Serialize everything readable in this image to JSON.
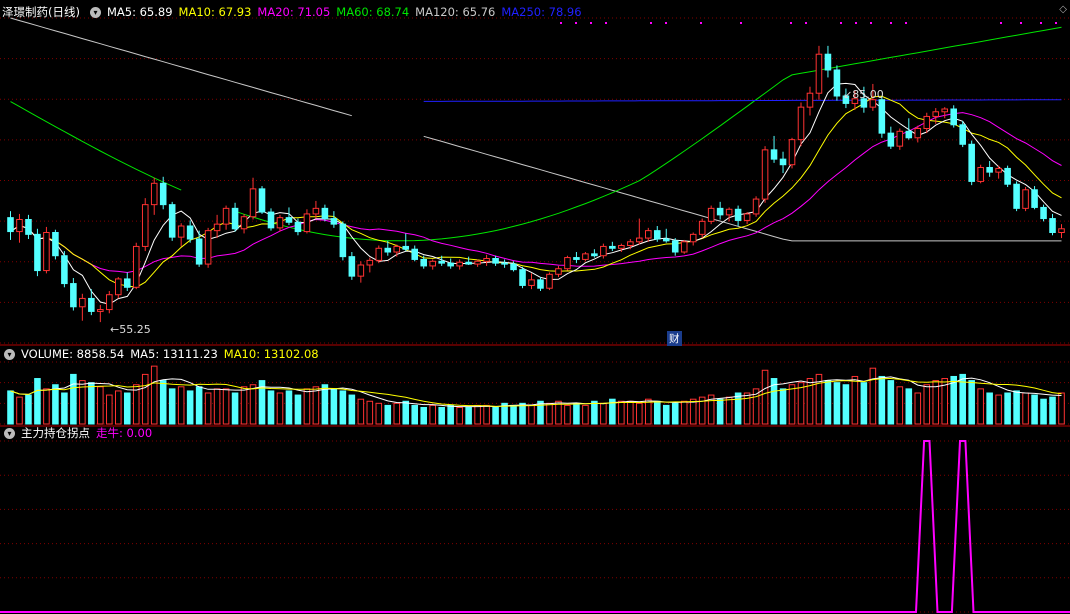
{
  "header": {
    "stock_name": "泽璟制药(日线)",
    "ma5": "MA5: 65.89",
    "ma10": "MA10: 67.93",
    "ma20": "MA20: 71.05",
    "ma60": "MA60: 68.74",
    "ma120": "MA120: 65.76",
    "ma250": "MA250: 78.96"
  },
  "volume_header": {
    "title": "VOLUME: 8858.54",
    "ma5": "MA5: 13111.23",
    "ma10": "MA10: 13102.08"
  },
  "indicator_header": {
    "title": "主力持仓拐点",
    "series": "走牛: 0.00"
  },
  "annotations": {
    "high_label": "85.00",
    "low_label": "55.25",
    "fin_marker": "财"
  },
  "colors": {
    "up": "#ff3232",
    "down": "#54ffff",
    "ma5": "#ffffff",
    "ma10": "#ffff00",
    "ma20": "#ff00ff",
    "ma60": "#00e600",
    "ma120": "#c8c8c8",
    "ma250": "#2020ff",
    "indicator": "#ff00ff",
    "grid": "#800000"
  },
  "chart_data": [
    {
      "type": "candlestick",
      "title": "泽璟制药(日线)",
      "price_range": [
        53,
        88
      ],
      "candles": [
        [
          66.5,
          67.2,
          64.1,
          65.0
        ],
        [
          65.0,
          66.9,
          63.8,
          66.3
        ],
        [
          66.3,
          66.8,
          64.2,
          64.7
        ],
        [
          64.7,
          65.3,
          60.2,
          60.8
        ],
        [
          60.8,
          65.5,
          60.5,
          64.9
        ],
        [
          64.9,
          65.2,
          62.0,
          62.4
        ],
        [
          62.4,
          62.9,
          59.0,
          59.4
        ],
        [
          59.4,
          60.0,
          56.5,
          56.9
        ],
        [
          56.9,
          58.3,
          55.4,
          57.8
        ],
        [
          57.8,
          58.8,
          56.0,
          56.4
        ],
        [
          56.4,
          57.1,
          55.25,
          56.6
        ],
        [
          56.6,
          58.6,
          56.2,
          58.2
        ],
        [
          58.2,
          60.1,
          57.8,
          59.9
        ],
        [
          59.9,
          60.6,
          58.6,
          59.0
        ],
        [
          59.0,
          63.8,
          58.8,
          63.4
        ],
        [
          63.4,
          68.6,
          62.9,
          67.9
        ],
        [
          67.9,
          70.8,
          66.8,
          70.2
        ],
        [
          70.2,
          70.9,
          67.4,
          67.9
        ],
        [
          67.9,
          68.2,
          64.0,
          64.4
        ],
        [
          64.4,
          65.9,
          63.4,
          65.6
        ],
        [
          65.6,
          66.2,
          63.8,
          64.2
        ],
        [
          64.2,
          65.1,
          61.2,
          61.5
        ],
        [
          61.5,
          65.4,
          61.1,
          65.1
        ],
        [
          65.1,
          66.8,
          64.3,
          65.8
        ],
        [
          65.8,
          67.8,
          65.2,
          67.5
        ],
        [
          67.5,
          68.1,
          65.0,
          65.3
        ],
        [
          65.3,
          66.9,
          64.8,
          66.6
        ],
        [
          66.6,
          70.8,
          66.3,
          69.6
        ],
        [
          69.6,
          69.9,
          66.9,
          67.1
        ],
        [
          67.1,
          67.5,
          65.1,
          65.4
        ],
        [
          65.4,
          66.8,
          65.0,
          66.5
        ],
        [
          66.5,
          67.6,
          65.7,
          66.0
        ],
        [
          66.0,
          66.4,
          64.6,
          65.0
        ],
        [
          65.0,
          67.4,
          64.8,
          66.9
        ],
        [
          66.9,
          68.3,
          66.4,
          67.5
        ],
        [
          67.5,
          67.9,
          66.1,
          66.4
        ],
        [
          66.4,
          67.2,
          65.4,
          65.8
        ],
        [
          65.8,
          66.1,
          61.9,
          62.3
        ],
        [
          62.3,
          62.8,
          59.8,
          60.2
        ],
        [
          60.2,
          61.8,
          59.5,
          61.4
        ],
        [
          61.4,
          62.2,
          60.6,
          61.9
        ],
        [
          61.9,
          63.5,
          61.6,
          63.2
        ],
        [
          63.2,
          64.0,
          62.4,
          62.8
        ],
        [
          62.8,
          63.6,
          62.3,
          63.4
        ],
        [
          63.4,
          64.8,
          62.9,
          63.1
        ],
        [
          63.1,
          63.5,
          61.8,
          62.0
        ],
        [
          62.0,
          62.4,
          61.0,
          61.3
        ],
        [
          61.3,
          62.0,
          60.9,
          61.8
        ],
        [
          61.8,
          62.4,
          61.3,
          61.6
        ],
        [
          61.6,
          62.1,
          61.0,
          61.3
        ],
        [
          61.3,
          62.0,
          60.9,
          61.7
        ],
        [
          61.7,
          62.3,
          61.4,
          61.5
        ],
        [
          61.5,
          62.0,
          61.2,
          61.8
        ],
        [
          61.8,
          62.5,
          61.3,
          62.1
        ],
        [
          62.1,
          62.4,
          61.3,
          61.6
        ],
        [
          61.6,
          62.0,
          61.1,
          61.5
        ],
        [
          61.5,
          61.8,
          60.7,
          60.9
        ],
        [
          60.9,
          61.2,
          58.9,
          59.2
        ],
        [
          59.2,
          60.5,
          58.8,
          59.8
        ],
        [
          59.8,
          60.1,
          58.6,
          58.9
        ],
        [
          58.9,
          60.6,
          58.7,
          60.4
        ],
        [
          60.4,
          61.3,
          60.1,
          61.0
        ],
        [
          61.0,
          62.4,
          60.8,
          62.2
        ],
        [
          62.2,
          62.8,
          61.6,
          62.0
        ],
        [
          62.0,
          62.8,
          61.8,
          62.6
        ],
        [
          62.6,
          63.1,
          62.2,
          62.4
        ],
        [
          62.4,
          63.7,
          62.1,
          63.4
        ],
        [
          63.4,
          63.9,
          62.9,
          63.2
        ],
        [
          63.2,
          63.7,
          62.8,
          63.5
        ],
        [
          63.5,
          64.2,
          63.1,
          63.9
        ],
        [
          63.9,
          66.4,
          63.6,
          64.3
        ],
        [
          64.3,
          65.4,
          63.9,
          65.1
        ],
        [
          65.1,
          65.6,
          63.9,
          64.2
        ],
        [
          64.2,
          65.3,
          63.8,
          64.0
        ],
        [
          64.0,
          64.3,
          62.4,
          62.8
        ],
        [
          62.8,
          64.1,
          62.6,
          63.9
        ],
        [
          63.9,
          64.9,
          63.5,
          64.7
        ],
        [
          64.7,
          66.4,
          64.3,
          66.1
        ],
        [
          66.1,
          67.8,
          65.8,
          67.5
        ],
        [
          67.5,
          68.2,
          66.3,
          66.8
        ],
        [
          66.8,
          67.6,
          66.1,
          67.4
        ],
        [
          67.4,
          67.8,
          65.6,
          66.2
        ],
        [
          66.2,
          67.1,
          65.8,
          66.9
        ],
        [
          66.9,
          68.8,
          66.6,
          68.5
        ],
        [
          68.5,
          74.2,
          68.1,
          73.8
        ],
        [
          73.8,
          75.3,
          72.4,
          72.8
        ],
        [
          72.8,
          73.6,
          71.3,
          72.2
        ],
        [
          72.2,
          75.1,
          71.8,
          74.9
        ],
        [
          74.9,
          78.9,
          74.2,
          78.4
        ],
        [
          78.4,
          80.6,
          77.5,
          79.9
        ],
        [
          79.9,
          85.0,
          79.2,
          84.1
        ],
        [
          84.1,
          85.0,
          81.6,
          82.4
        ],
        [
          82.4,
          82.9,
          79.1,
          79.6
        ],
        [
          79.6,
          80.4,
          78.3,
          78.8
        ],
        [
          78.8,
          80.2,
          78.1,
          79.3
        ],
        [
          79.3,
          80.6,
          77.8,
          78.4
        ],
        [
          78.4,
          80.9,
          78.0,
          79.2
        ],
        [
          79.2,
          79.6,
          75.1,
          75.6
        ],
        [
          75.6,
          76.3,
          73.9,
          74.2
        ],
        [
          74.2,
          76.1,
          73.8,
          75.8
        ],
        [
          75.8,
          77.2,
          74.9,
          75.1
        ],
        [
          75.1,
          76.4,
          74.6,
          76.1
        ],
        [
          76.1,
          77.8,
          75.6,
          77.4
        ],
        [
          77.4,
          78.3,
          76.6,
          77.9
        ],
        [
          77.9,
          78.4,
          77.2,
          78.2
        ],
        [
          78.2,
          78.6,
          76.2,
          76.5
        ],
        [
          76.5,
          76.9,
          74.1,
          74.4
        ],
        [
          74.4,
          74.8,
          70.0,
          70.4
        ],
        [
          70.4,
          72.2,
          70.2,
          71.9
        ],
        [
          71.9,
          72.6,
          70.9,
          71.4
        ],
        [
          71.4,
          72.1,
          70.7,
          71.8
        ],
        [
          71.8,
          72.1,
          69.8,
          70.1
        ],
        [
          70.1,
          70.4,
          67.2,
          67.5
        ],
        [
          67.5,
          69.8,
          67.2,
          69.5
        ],
        [
          69.5,
          69.9,
          67.4,
          67.6
        ],
        [
          67.6,
          67.9,
          66.1,
          66.4
        ],
        [
          66.4,
          66.9,
          64.6,
          64.9
        ],
        [
          64.9,
          65.8,
          64.3,
          65.3
        ]
      ],
      "ma_series": {
        "MA5": {
          "last": 65.89
        },
        "MA10": {
          "last": 67.93
        },
        "MA20": {
          "last": 71.05
        },
        "MA60": {
          "last": 68.74
        },
        "MA120": {
          "last": 65.76
        },
        "MA250": {
          "last": 78.96
        }
      },
      "high_marker": 85.0,
      "low_marker": 55.25
    },
    {
      "type": "bar",
      "title": "VOLUME: 8858.54",
      "volumes": [
        16,
        13,
        14,
        22,
        17,
        19,
        15,
        24,
        21,
        20,
        18,
        14,
        16,
        15,
        19,
        24,
        28,
        21,
        17,
        18,
        16,
        18,
        15,
        17,
        17,
        15,
        18,
        19,
        21,
        16,
        15,
        16,
        14,
        17,
        18,
        19,
        17,
        16,
        14,
        12,
        11,
        10,
        9,
        10,
        11,
        9,
        8,
        9,
        8,
        9,
        8,
        8,
        9,
        9,
        8,
        10,
        9,
        10,
        9,
        11,
        10,
        11,
        9,
        10,
        9,
        11,
        10,
        12,
        11,
        11,
        10,
        12,
        11,
        9,
        10,
        11,
        12,
        13,
        14,
        12,
        13,
        15,
        15,
        17,
        26,
        22,
        17,
        19,
        20,
        22,
        24,
        21,
        20,
        19,
        23,
        20,
        27,
        23,
        21,
        18,
        17,
        15,
        19,
        21,
        22,
        23,
        24,
        21,
        17,
        15,
        14,
        15,
        16,
        15,
        14,
        12,
        13,
        15
      ],
      "ylim": [
        0,
        30
      ]
    },
    {
      "type": "line",
      "title": "主力持仓拐点",
      "series": [
        {
          "name": "走牛",
          "peaks_at_index": [
            102,
            106
          ]
        }
      ],
      "ylim": [
        0,
        1
      ]
    }
  ]
}
